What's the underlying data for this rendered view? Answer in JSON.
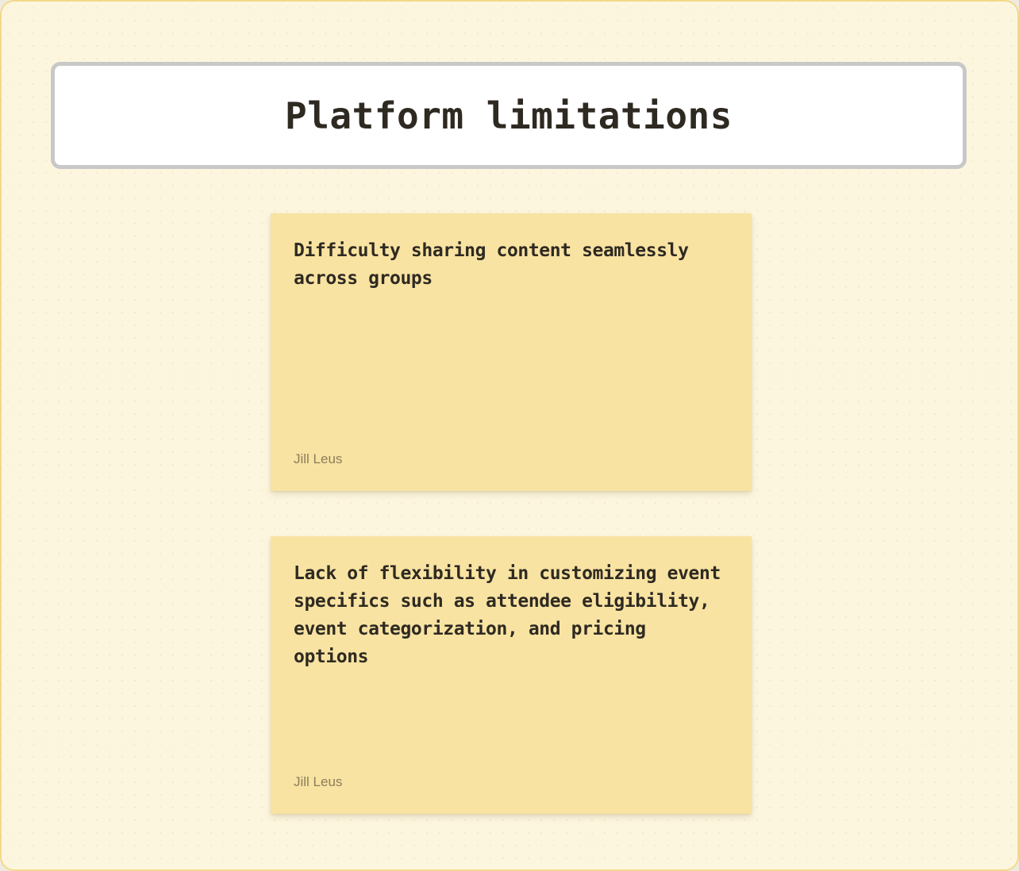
{
  "board": {
    "title": "Platform limitations",
    "notes": [
      {
        "text": "Difficulty sharing content seamlessly across groups",
        "author": "Jill Leus"
      },
      {
        "text": "Lack of flexibility in customizing event specifics such as attendee eligibility, event categorization, and pricing options",
        "author": "Jill Leus"
      }
    ]
  },
  "colors": {
    "background": "#fdf6df",
    "border": "#f3d98a",
    "sticky": "#f9e3a2",
    "title_border": "#c8c8c8",
    "text": "#2e2a22",
    "author": "#8a7d5c"
  }
}
